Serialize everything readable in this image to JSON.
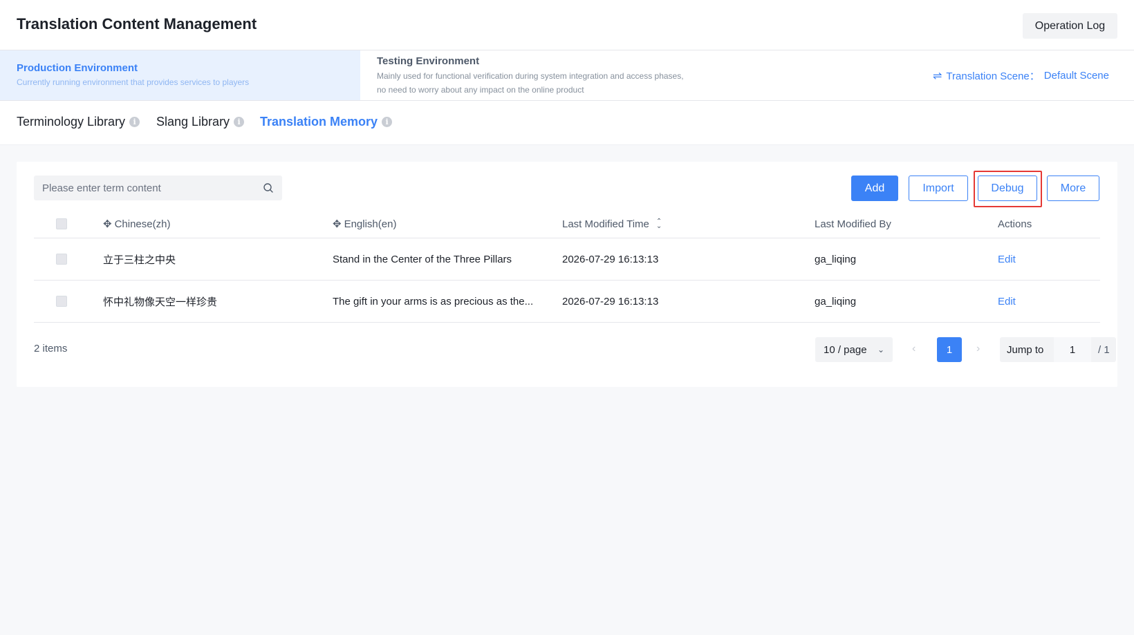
{
  "header": {
    "title": "Translation Content Management",
    "operation_log": "Operation Log"
  },
  "environments": {
    "production": {
      "name": "Production Environment",
      "description": "Currently running environment that provides services to players"
    },
    "testing": {
      "name": "Testing Environment",
      "description": "Mainly used for functional verification during system integration and access phases, no need to worry about any impact on the online product"
    },
    "scene": {
      "label": "Translation Scene：",
      "value": "Default Scene"
    }
  },
  "tabs": [
    {
      "label": "Terminology Library",
      "active": false
    },
    {
      "label": "Slang Library",
      "active": false
    },
    {
      "label": "Translation Memory",
      "active": true
    }
  ],
  "toolbar": {
    "search_placeholder": "Please enter term content",
    "add": "Add",
    "import": "Import",
    "debug": "Debug",
    "more": "More"
  },
  "table": {
    "columns": [
      "Chinese(zh)",
      "English(en)",
      "Last Modified Time",
      "Last Modified By",
      "Actions"
    ],
    "rows": [
      {
        "zh": "立于三柱之中央",
        "en": "Stand in the Center of the Three Pillars",
        "time": "2026-07-29 16:13:13",
        "by": "ga_liqing",
        "action": "Edit"
      },
      {
        "zh": "怀中礼物像天空一样珍贵",
        "en": "The gift in your arms is as precious as the...",
        "time": "2026-07-29 16:13:13",
        "by": "ga_liqing",
        "action": "Edit"
      }
    ]
  },
  "pagination": {
    "total": "2 items",
    "page_size": "10 / page",
    "current": "1",
    "jump_label": "Jump to",
    "jump_value": "1",
    "total_pages": "/ 1"
  },
  "colors": {
    "primary": "#3b82f6",
    "highlight": "#e53935"
  }
}
